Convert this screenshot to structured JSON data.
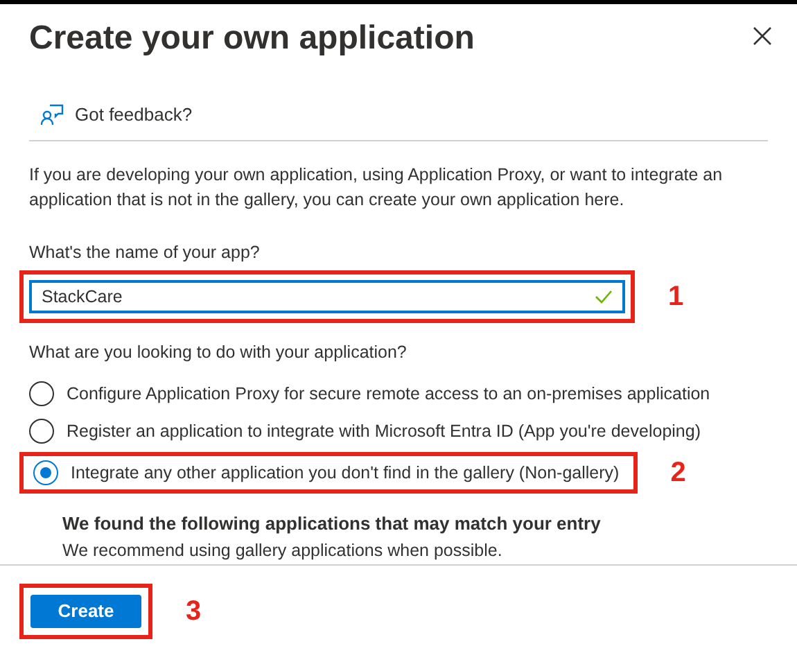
{
  "dialog": {
    "title": "Create your own application",
    "feedback": "Got feedback?",
    "description": "If you are developing your own application, using Application Proxy, or want to integrate an application that is not in the gallery, you can create your own application here.",
    "name_label": "What's the name of your app?",
    "name_field": {
      "value": "StackCare",
      "valid": true,
      "annotation": "1"
    },
    "purpose_label": "What are you looking to do with your application?",
    "options": [
      {
        "label": "Configure Application Proxy for secure remote access to an on-premises application",
        "selected": false
      },
      {
        "label": "Register an application to integrate with Microsoft Entra ID (App you're developing)",
        "selected": false
      },
      {
        "label": "Integrate any other application you don't find in the gallery (Non-gallery)",
        "selected": true,
        "annotation": "2"
      }
    ],
    "matches": {
      "heading": "We found the following applications that may match your entry",
      "note": "We recommend using gallery applications when possible."
    },
    "create_button": {
      "label": "Create",
      "annotation": "3"
    }
  }
}
